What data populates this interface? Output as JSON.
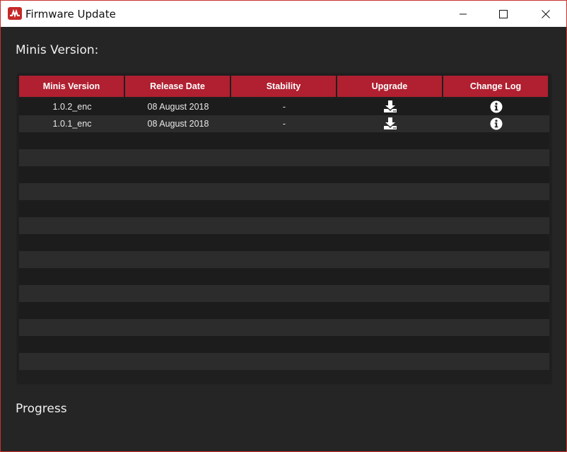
{
  "window": {
    "title": "Firmware Update",
    "accent_color": "#b02030",
    "icons": [
      "app-logo-icon",
      "minimize-icon",
      "maximize-icon",
      "close-icon"
    ]
  },
  "sections": {
    "versions_title": "Minis Version:",
    "progress_title": "Progress"
  },
  "table": {
    "columns": [
      "Minis Version",
      "Release Date",
      "Stability",
      "Upgrade",
      "Change Log"
    ],
    "rows": [
      {
        "version": "1.0.2_enc",
        "date": "08 August 2018",
        "stability": "-",
        "upgrade_icon": "download-icon",
        "changelog_icon": "info-icon"
      },
      {
        "version": "1.0.1_enc",
        "date": "08 August 2018",
        "stability": "-",
        "upgrade_icon": "download-icon",
        "changelog_icon": "info-icon"
      }
    ]
  }
}
